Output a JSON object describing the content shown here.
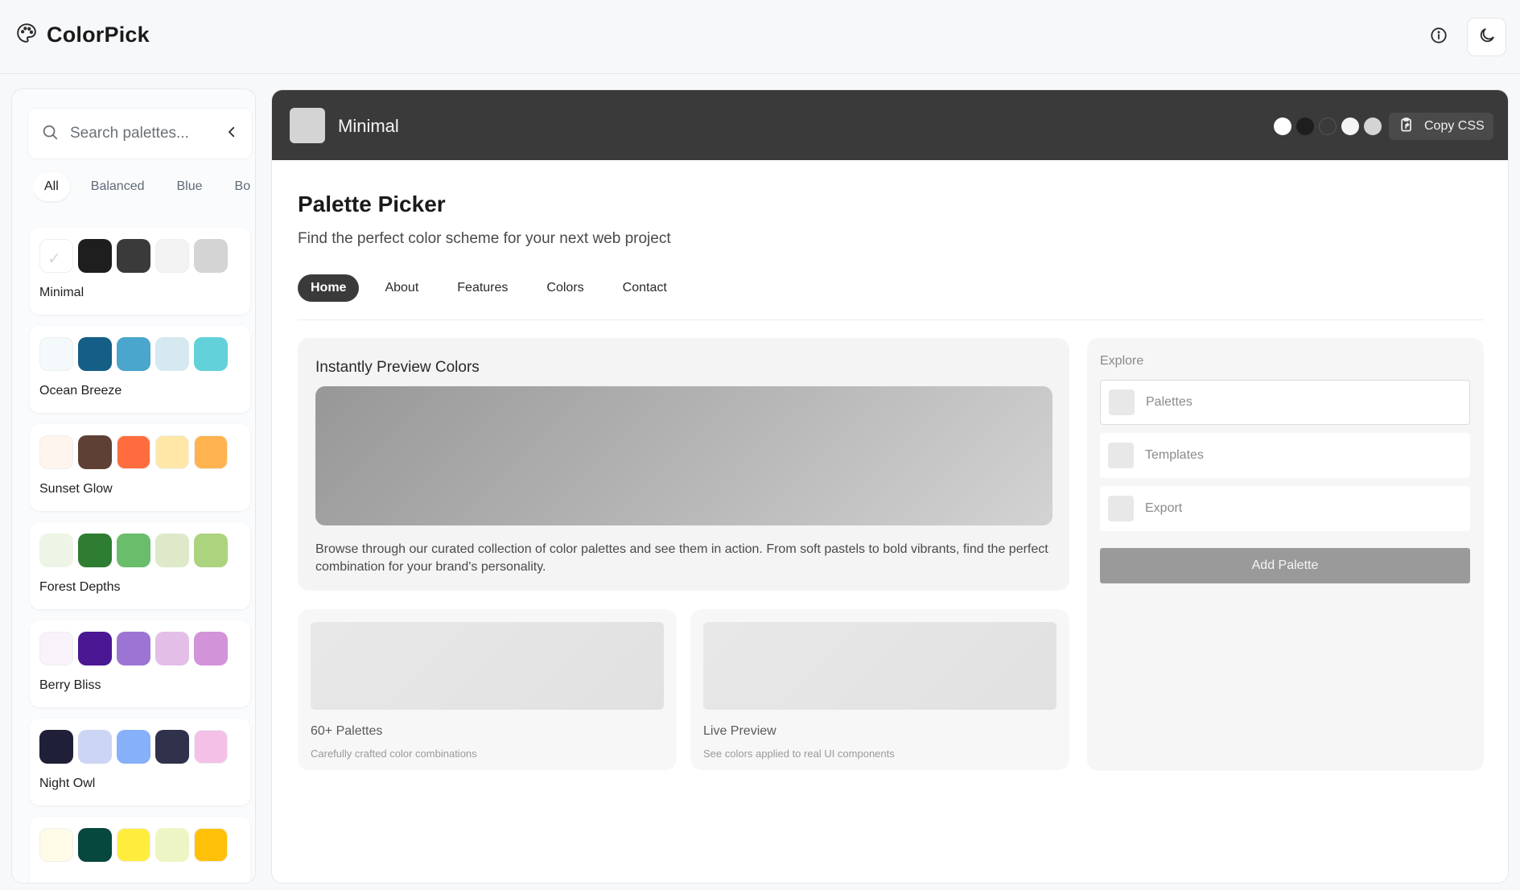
{
  "app": {
    "name": "ColorPick"
  },
  "sidebar": {
    "search_placeholder": "Search palettes...",
    "filters": [
      "All",
      "Balanced",
      "Blue",
      "Bo"
    ],
    "active_filter": "All",
    "palettes": [
      {
        "name": "Minimal",
        "selected": true,
        "colors": [
          "#ffffff",
          "#1e1e1e",
          "#3a3a3a",
          "#f3f3f3",
          "#d4d4d4"
        ]
      },
      {
        "name": "Ocean Breeze",
        "colors": [
          "#f4f9fb",
          "#155e86",
          "#4aa6cc",
          "#d6e8f0",
          "#63d1da"
        ]
      },
      {
        "name": "Sunset Glow",
        "colors": [
          "#fff5ef",
          "#5e4035",
          "#ff6c3d",
          "#ffe7a8",
          "#ffb34f"
        ]
      },
      {
        "name": "Forest Depths",
        "colors": [
          "#eef5e6",
          "#2e7d32",
          "#69bd6b",
          "#dde9c8",
          "#acd37e"
        ]
      },
      {
        "name": "Berry Bliss",
        "colors": [
          "#f8f2fa",
          "#4b1793",
          "#9c75d4",
          "#e3bfe8",
          "#d293d9"
        ]
      },
      {
        "name": "Night Owl",
        "colors": [
          "#1f1f37",
          "#cdd5f5",
          "#86b0fa",
          "#2f324a",
          "#f4c0e8"
        ]
      },
      {
        "name": "",
        "colors": [
          "#fffbe6",
          "#06473e",
          "#ffec3d",
          "#eef5c4",
          "#ffc107"
        ]
      }
    ]
  },
  "header": {
    "palette_name": "Minimal",
    "swatch_color": "#d4d4d4",
    "dots": [
      "#ffffff",
      "#1e1e1e",
      "#3a3a3a",
      "#f3f3f3",
      "#d4d4d4"
    ],
    "copy_label": "Copy CSS"
  },
  "main": {
    "title": "Palette Picker",
    "subtitle": "Find the perfect color scheme for your next web project",
    "tabs": [
      "Home",
      "About",
      "Features",
      "Colors",
      "Contact"
    ],
    "active_tab": "Home",
    "preview": {
      "title": "Instantly Preview Colors",
      "description": "Browse through our curated collection of color palettes and see them in action. From soft pastels to bold vibrants, find the perfect combination for your brand's personality."
    },
    "features": [
      {
        "title": "60+ Palettes",
        "desc": "Carefully crafted color combinations"
      },
      {
        "title": "Live Preview",
        "desc": "See colors applied to real UI components"
      }
    ],
    "explore": {
      "label": "Explore",
      "items": [
        "Palettes",
        "Templates",
        "Export"
      ],
      "button": "Add Palette"
    }
  }
}
